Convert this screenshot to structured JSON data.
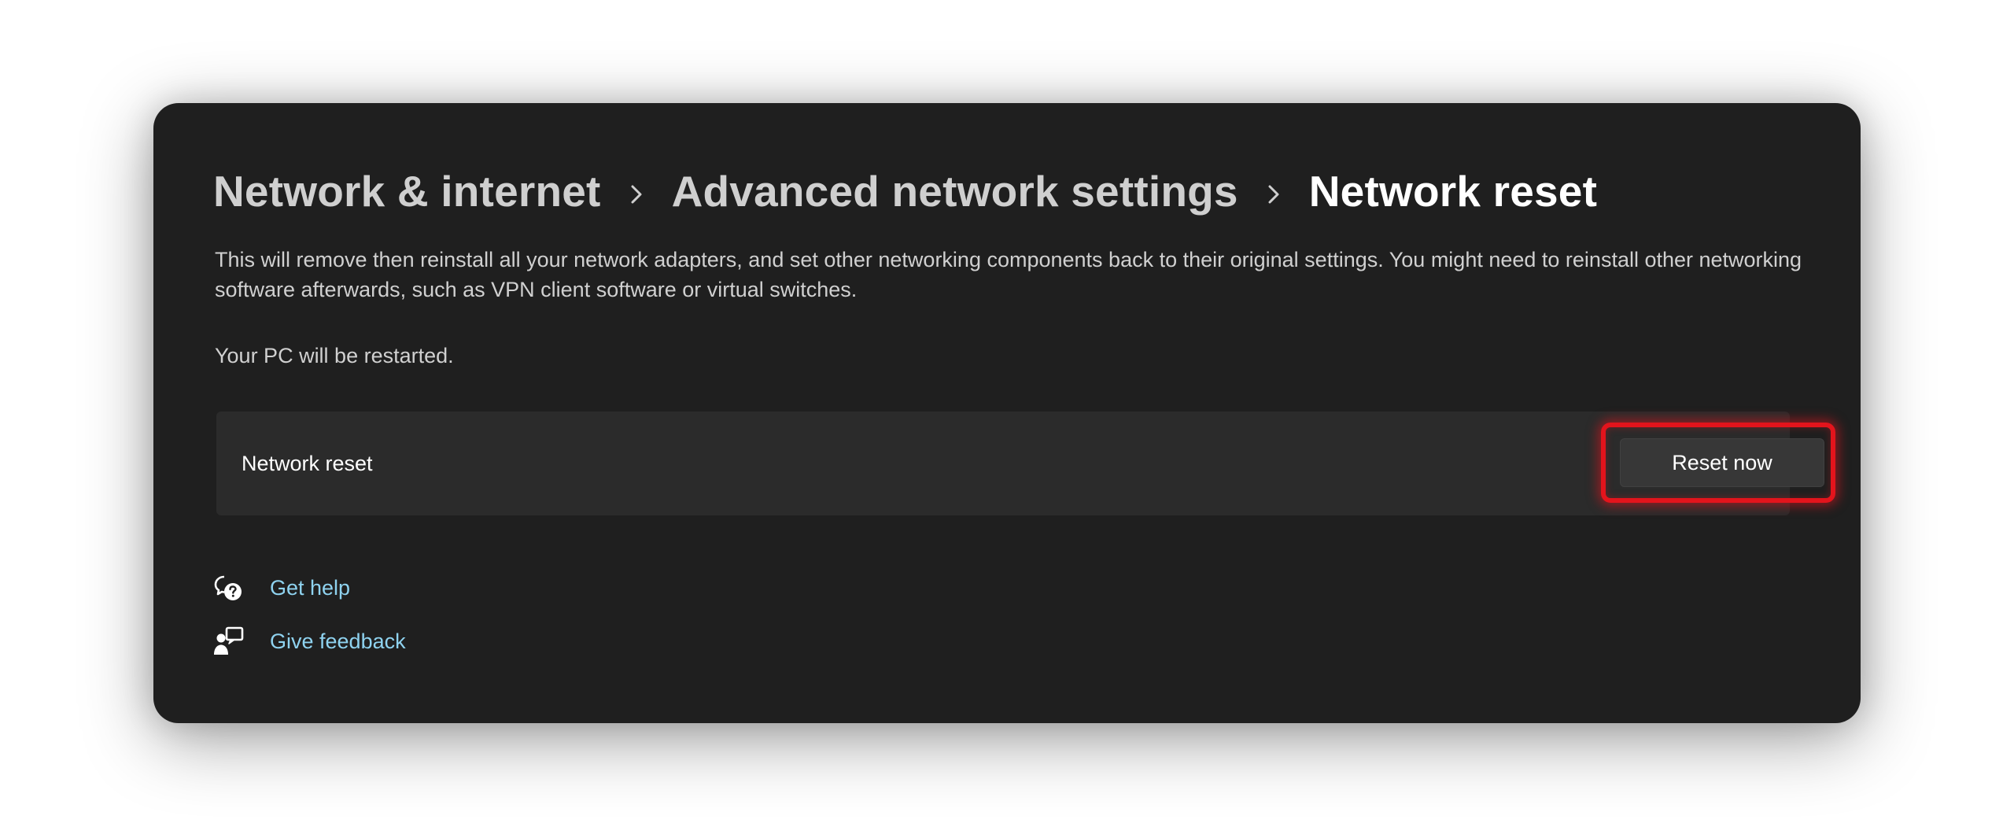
{
  "breadcrumb": {
    "items": [
      {
        "label": "Network & internet"
      },
      {
        "label": "Advanced network settings"
      },
      {
        "label": "Network reset"
      }
    ]
  },
  "description": "This will remove then reinstall all your network adapters, and set other networking components back to their original settings. You might need to reinstall other networking software afterwards, such as VPN client software or virtual switches.",
  "restart_note": "Your PC will be restarted.",
  "reset_card": {
    "label": "Network reset",
    "button_label": "Reset now"
  },
  "links": {
    "get_help": {
      "label": "Get help",
      "icon": "get-help-icon"
    },
    "give_feedback": {
      "label": "Give feedback",
      "icon": "feedback-icon"
    }
  },
  "colors": {
    "background": "#1f1f1f",
    "card": "#2b2b2b",
    "link": "#8fd3f0",
    "highlight": "#e3141c"
  }
}
